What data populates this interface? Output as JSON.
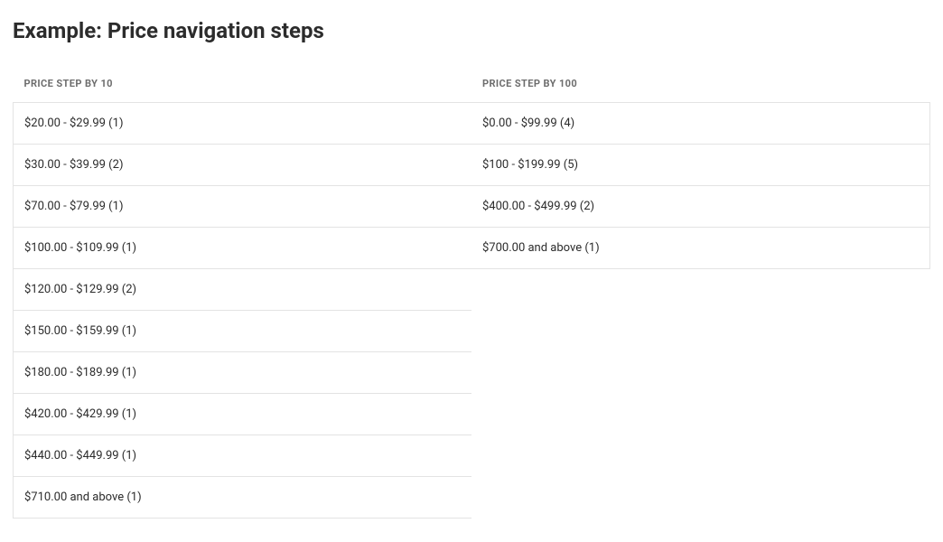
{
  "title": "Example: Price navigation steps",
  "headers": {
    "col1": "PRICE STEP BY 10",
    "col2": "PRICE STEP BY 100"
  },
  "rows": [
    {
      "col1": "$20.00 - $29.99 (1)",
      "col2": "$0.00 - $99.99 (4)"
    },
    {
      "col1": "$30.00 - $39.99 (2)",
      "col2": "$100 - $199.99 (5)"
    },
    {
      "col1": "$70.00 - $79.99 (1)",
      "col2": "$400.00 - $499.99 (2)"
    },
    {
      "col1": "$100.00 - $109.99 (1)",
      "col2": "$700.00 and above (1)"
    },
    {
      "col1": "$120.00 - $129.99 (2)",
      "col2": ""
    },
    {
      "col1": "$150.00 - $159.99 (1)",
      "col2": ""
    },
    {
      "col1": "$180.00 - $189.99 (1)",
      "col2": ""
    },
    {
      "col1": "$420.00 - $429.99 (1)",
      "col2": ""
    },
    {
      "col1": "$440.00 - $449.99 (1)",
      "col2": ""
    },
    {
      "col1": "$710.00 and above (1)",
      "col2": ""
    }
  ]
}
